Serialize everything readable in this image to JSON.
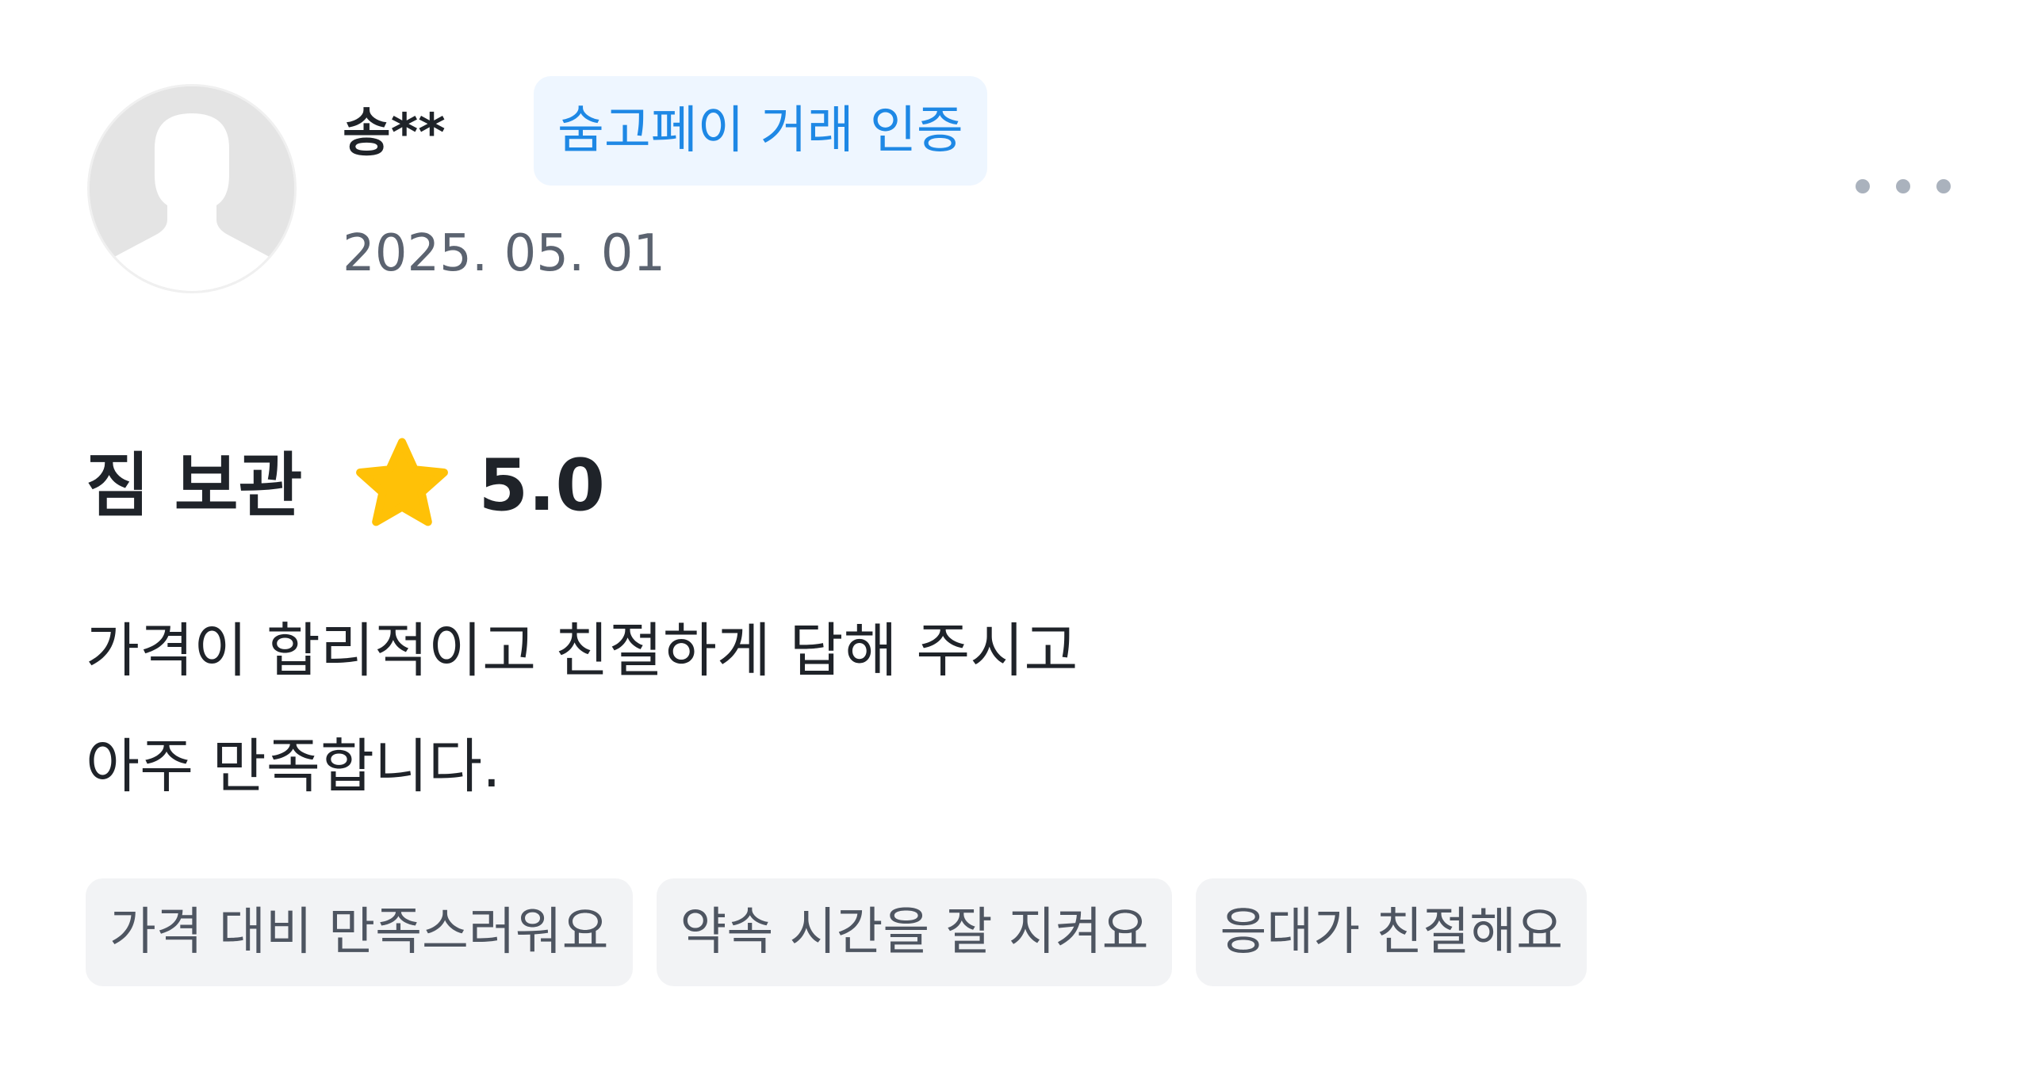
{
  "review": {
    "user_name": "송**",
    "badge_label": "숨고페이 거래 인증",
    "date": "2025. 05. 01",
    "service": "짐 보관",
    "rating": "5.0",
    "text_lines": [
      "가격이 합리적이고 친절하게 답해 주시고",
      "아주 만족합니다."
    ],
    "tags": [
      "가격 대비 만족스러워요",
      "약속 시간을 잘 지켜요",
      "응대가 친절해요"
    ]
  },
  "icons": {
    "avatar": "default-user-avatar-icon",
    "rating": "star-icon",
    "more": "more-options-icon"
  },
  "colors": {
    "badge_text": "#1e88e5",
    "badge_bg": "#eef6ff",
    "star": "#ffc107",
    "tag_bg": "#f2f3f5",
    "date_text": "#5b6370"
  }
}
